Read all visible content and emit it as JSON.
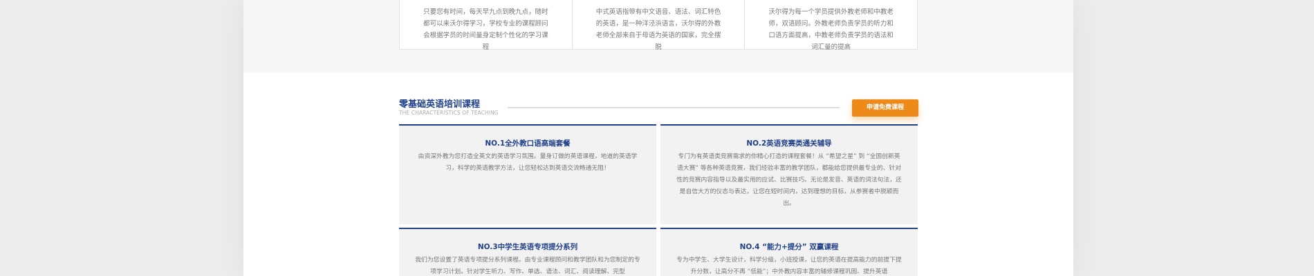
{
  "top_cards": [
    "只要您有时间，每天早九点到晚九点，随时都可以来沃尔得学习，学校专业的课程顾问会根据学员的时间量身定制个性化的学习课程",
    "中式英语指带有中文语音、语法、词汇特色的英语，是一种洋泾浜语言，沃尔得的外教老师全部来自于母语为英语的国家，完全摆脱",
    "沃尔得为每一个学员提供外教老师和中教老师，双语顾问。外教老师负责学员的听力和口语方面提高，中教老师负责学员的语法和词汇量的提高"
  ],
  "section": {
    "title": "零基础英语培训课程",
    "subtitle": "THE CHARACTERISTICS OF TEACHING",
    "apply_button": "申请免费课程"
  },
  "courses": [
    {
      "title": "NO.1全外教口语高端套餐",
      "desc": "由资深外教为您打造全英文的英语学习氛围。量身订做的英语课程，地道的英语学习，科学的英语教学方法，让您轻松达到英语交流畅通无阻！"
    },
    {
      "title": "NO.2英语竞赛类通关辅导",
      "desc": "专门为有英语类竞赛需求的你精心打造的课程套餐！从 “希望之星” 到 “全国创新英语大赛” 等各种英语竞赛，我们经验丰富的教学团队，都能给您提供最专业的、针对性的竞赛内容指导以及最实用的应试、比赛技巧。无论是发音、英语的词法句法，还是自信大方的仪态与表达，让您在短时间内，达到理想的目标，从参赛者中脱颖而出。"
    },
    {
      "title": "NO.3中学生英语专项提分系列",
      "desc": "我们为您设置了英语专项提分系列课程。由专业课程顾问和教学团队和为您制定的专项学习计划。针对学生听力、写作、单选、语法、词汇、阅读理解、完型"
    },
    {
      "title": "NO.4 “能力+提分” 双赢课程",
      "desc": "专为中学生、大学生设计，科学分级，小班授课，让您的英语在提高能力的前提下提升分数，让高分不再 “低能”；中外教内容丰富的辅修课程巩固、提升英语"
    }
  ]
}
